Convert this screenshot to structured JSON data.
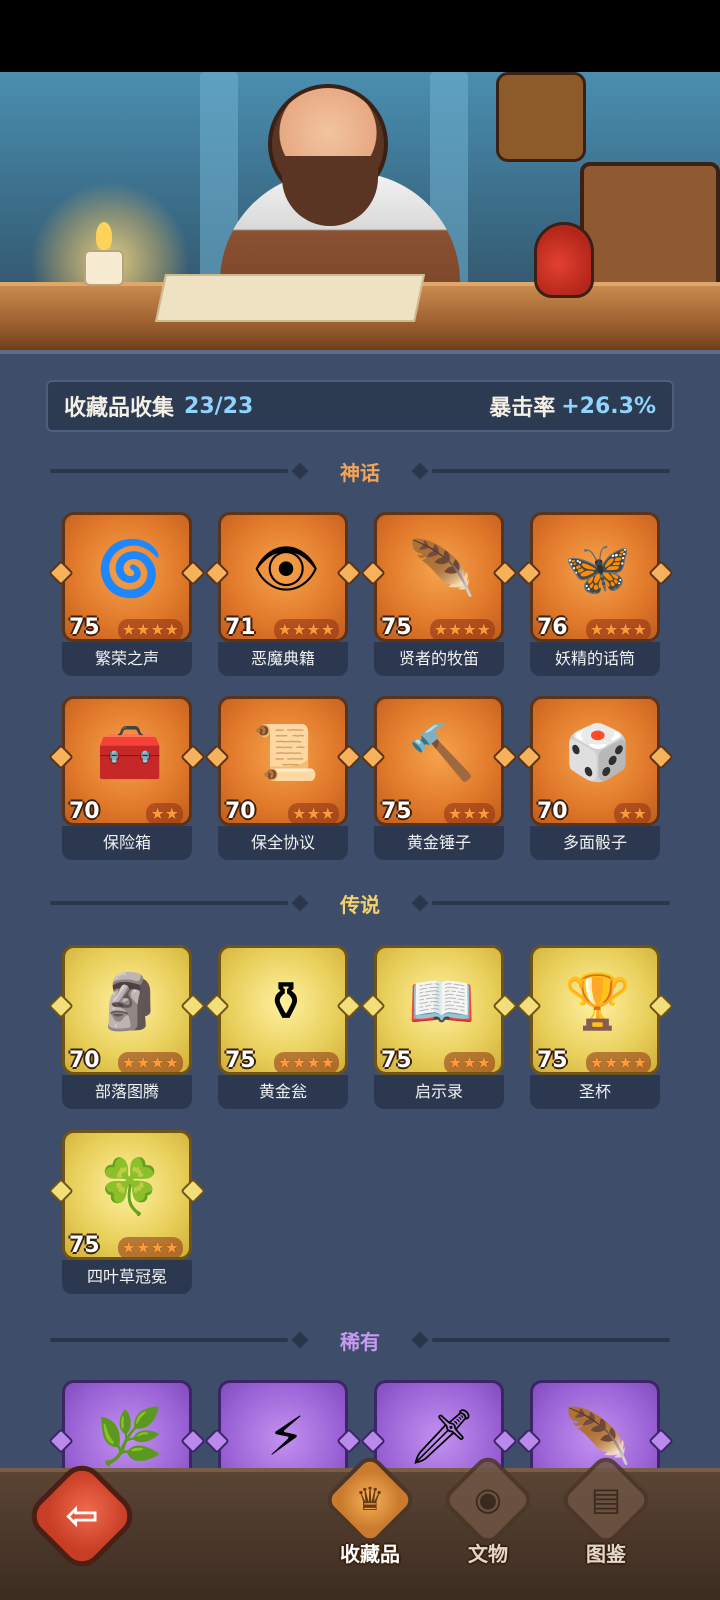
{
  "summary": {
    "label": "收藏品收集",
    "count": "23/23",
    "crit_label": "暴击率",
    "crit_value": "+26.3%"
  },
  "sections": {
    "mythic": {
      "title": "神话",
      "color": "#f2a45a"
    },
    "legend": {
      "title": "传说",
      "color": "#f4d06a"
    },
    "rare": {
      "title": "稀有",
      "color": "#c79af2"
    }
  },
  "mythic_items": [
    {
      "name": "繁荣之声",
      "level": "75",
      "stars": 4,
      "icon": "swirl-orb-icon"
    },
    {
      "name": "恶魔典籍",
      "level": "71",
      "stars": 4,
      "icon": "eye-book-icon"
    },
    {
      "name": "贤者的牧笛",
      "level": "75",
      "stars": 4,
      "icon": "flute-icon"
    },
    {
      "name": "妖精的话筒",
      "level": "76",
      "stars": 4,
      "icon": "fairy-mic-icon"
    },
    {
      "name": "保险箱",
      "level": "70",
      "stars": 2,
      "icon": "treasure-chest-icon"
    },
    {
      "name": "保全协议",
      "level": "70",
      "stars": 3,
      "icon": "scroll-icon"
    },
    {
      "name": "黄金锤子",
      "level": "75",
      "stars": 3,
      "icon": "hammer-icon"
    },
    {
      "name": "多面骰子",
      "level": "70",
      "stars": 2,
      "icon": "dice-icon"
    }
  ],
  "legend_items": [
    {
      "name": "部落图腾",
      "level": "70",
      "stars": 4,
      "icon": "totem-icon"
    },
    {
      "name": "黄金瓮",
      "level": "75",
      "stars": 4,
      "icon": "urn-icon"
    },
    {
      "name": "启示录",
      "level": "75",
      "stars": 3,
      "icon": "open-book-icon"
    },
    {
      "name": "圣杯",
      "level": "75",
      "stars": 4,
      "icon": "chalice-icon"
    },
    {
      "name": "四叶草冠冕",
      "level": "75",
      "stars": 4,
      "icon": "clover-crown-icon"
    }
  ],
  "rare_items": [
    {
      "icon": "vine-icon"
    },
    {
      "icon": "lightning-card-icon"
    },
    {
      "icon": "skull-sword-icon"
    },
    {
      "icon": "feather-icon"
    }
  ],
  "nav": {
    "collectibles": "收藏品",
    "artifacts": "文物",
    "codex": "图鉴"
  }
}
